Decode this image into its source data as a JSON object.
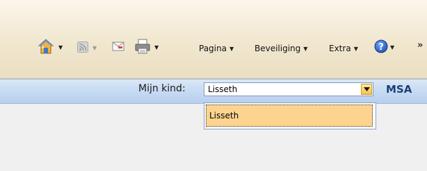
{
  "toolbar": {
    "items": [
      {
        "icon": "home-icon"
      },
      {
        "icon": "rss-feed-icon"
      },
      {
        "icon": "mail-icon"
      },
      {
        "icon": "print-icon"
      }
    ],
    "menus": [
      "Pagina",
      "Beveiliging",
      "Extra"
    ],
    "help_icon": "help-icon",
    "overflow": "»"
  },
  "header": {
    "child_label": "Mijn kind:",
    "child_select": {
      "value": "Lisseth",
      "options": [
        "Lisseth"
      ]
    },
    "brand": "MSA"
  },
  "colors": {
    "cmdbar": "#f1e7cf",
    "appbar": "#c6daf2",
    "highlight": "#fcd48f",
    "brand": "#1d3e7a"
  }
}
